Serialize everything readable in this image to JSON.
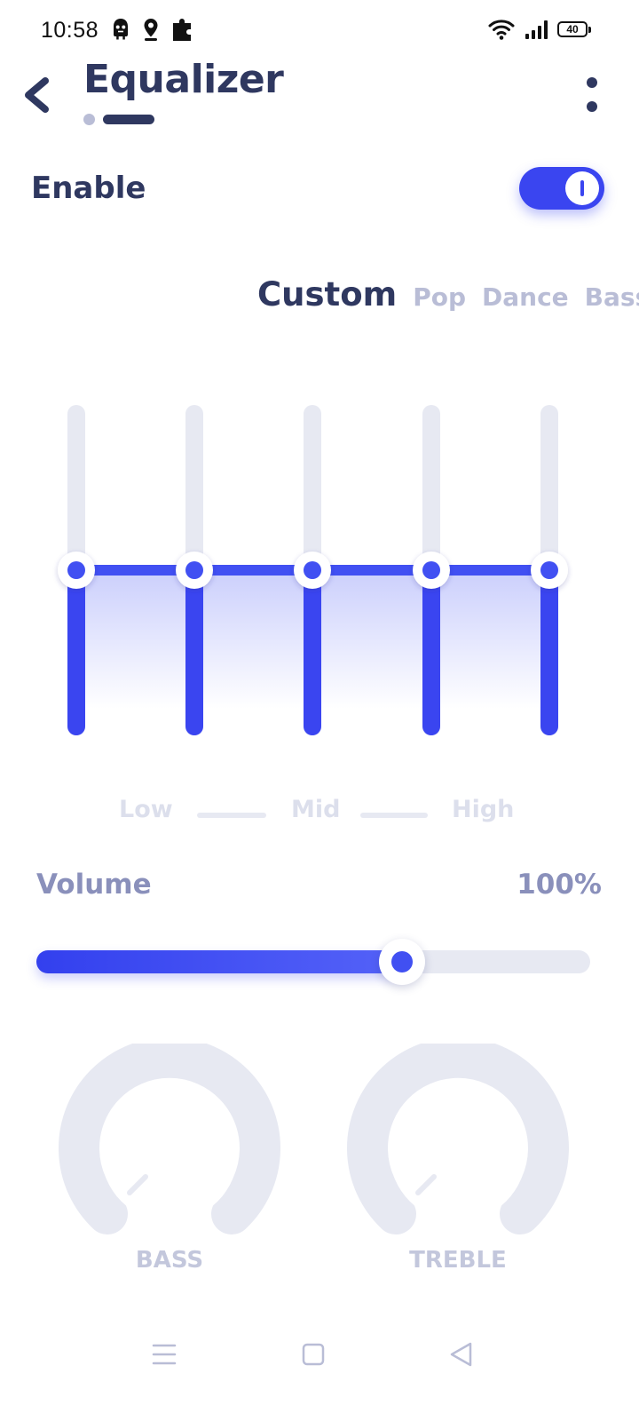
{
  "status_bar": {
    "time": "10:58",
    "battery": "40",
    "left_icons": [
      "ghost-icon",
      "location-icon",
      "puzzle-icon"
    ],
    "right_icons": [
      "wifi-icon",
      "signal-icon",
      "battery-icon"
    ]
  },
  "header": {
    "title": "Equalizer",
    "back_icon": "chevron-left-icon",
    "more_icon": "more-vertical-icon",
    "page_indicator": {
      "pages": 2,
      "active": 1
    }
  },
  "enable": {
    "label": "Enable",
    "on": true
  },
  "presets": [
    {
      "label": "Custom",
      "active": true
    },
    {
      "label": "Pop",
      "active": false
    },
    {
      "label": "Dance",
      "active": false
    },
    {
      "label": "Bass",
      "active": false
    }
  ],
  "equalizer": {
    "bands": [
      {
        "level": 0.5
      },
      {
        "level": 0.5
      },
      {
        "level": 0.5
      },
      {
        "level": 0.5
      },
      {
        "level": 0.5
      }
    ]
  },
  "frequency_labels": {
    "low": "Low",
    "mid": "Mid",
    "high": "High"
  },
  "volume": {
    "label": "Volume",
    "value_text": "100%",
    "slider_level": 0.66
  },
  "knobs": {
    "bass": {
      "label": "BASS",
      "level": 0
    },
    "treble": {
      "label": "TREBLE",
      "level": 0
    }
  },
  "colors": {
    "accent": "#3a45f0",
    "title": "#2f3860",
    "muted": "#b9bdd6",
    "track": "#e7e9f2"
  },
  "nav_bar": {
    "icons": [
      "menu-icon",
      "home-icon",
      "back-icon"
    ]
  }
}
